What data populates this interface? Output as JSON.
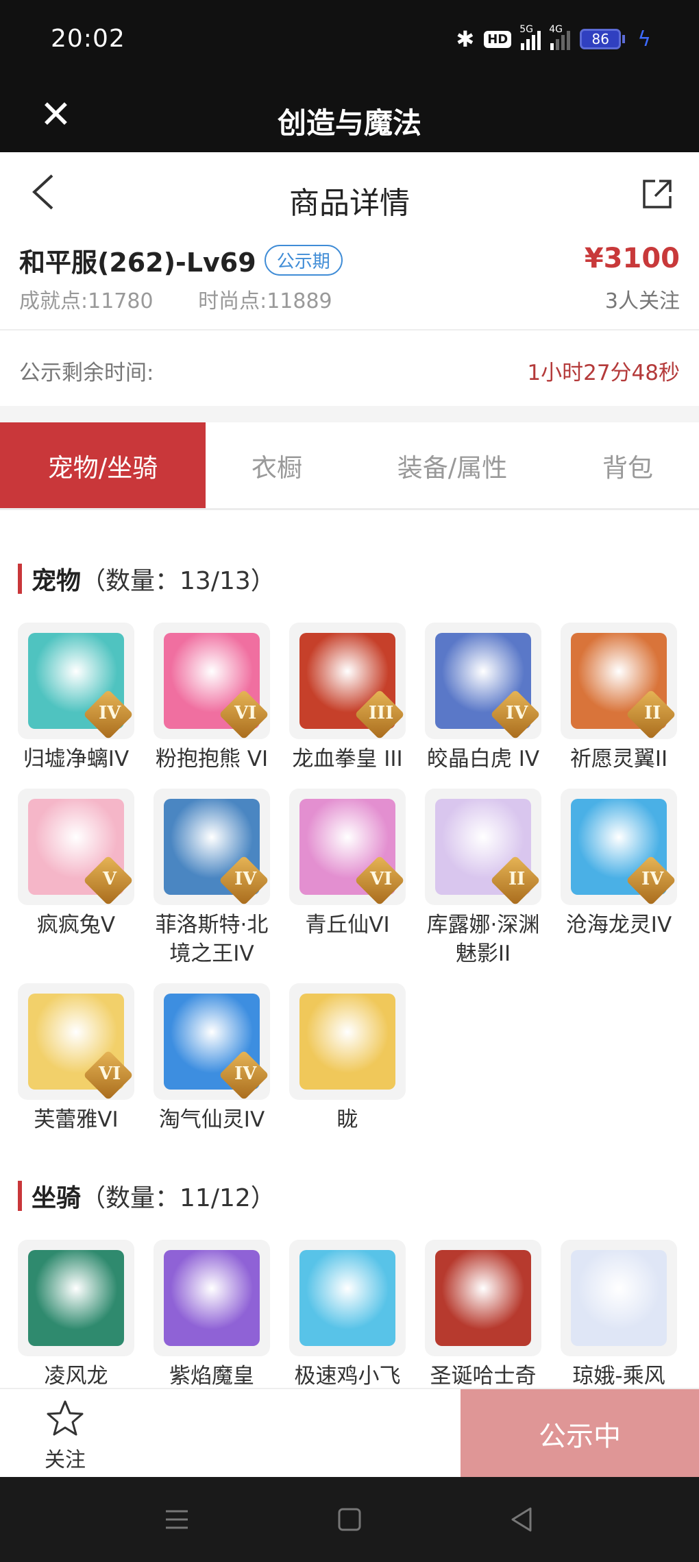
{
  "status_bar": {
    "time": "20:02",
    "hd": "HD",
    "net1": "5G",
    "net2": "4G",
    "battery": "86"
  },
  "app_bar": {
    "title": "创造与魔法"
  },
  "nav": {
    "title": "商品详情"
  },
  "product": {
    "name": "和平服(262)-Lv69",
    "badge": "公示期",
    "price": "¥3100",
    "achievement": "成就点:11780",
    "fashion": "时尚点:11889",
    "followers": "3人关注"
  },
  "timer": {
    "label": "公示剩余时间:",
    "value": "1小时27分48秒"
  },
  "tabs": [
    {
      "label": "宠物/坐骑"
    },
    {
      "label": "衣橱"
    },
    {
      "label": "装备/属性"
    },
    {
      "label": "背包"
    }
  ],
  "pets": {
    "title": "宠物",
    "count": "（数量：13/13）",
    "items": [
      {
        "label": "归墟净螭IV",
        "rank": "IV",
        "color": "#4fc3c0"
      },
      {
        "label": "粉抱抱熊 VI",
        "rank": "VI",
        "color": "#f06fa0"
      },
      {
        "label": "龙血拳皇 III",
        "rank": "III",
        "color": "#c6402a"
      },
      {
        "label": "皎晶白虎 IV",
        "rank": "IV",
        "color": "#5a78c8"
      },
      {
        "label": "祈愿灵翼II",
        "rank": "II",
        "color": "#d9743a"
      },
      {
        "label": "疯疯兔V",
        "rank": "V",
        "color": "#f5b6c8"
      },
      {
        "label": "菲洛斯特·北境之王IV",
        "rank": "IV",
        "color": "#4a86c2"
      },
      {
        "label": "青丘仙VI",
        "rank": "VI",
        "color": "#e38fd0"
      },
      {
        "label": "库露娜·深渊魅影II",
        "rank": "II",
        "color": "#d9c6ee"
      },
      {
        "label": "沧海龙灵IV",
        "rank": "IV",
        "color": "#4ab0e6"
      },
      {
        "label": "芙蕾雅VI",
        "rank": "VI",
        "color": "#f2d06a"
      },
      {
        "label": "淘气仙灵IV",
        "rank": "IV",
        "color": "#3d8ee0"
      },
      {
        "label": "眬",
        "rank": "",
        "color": "#f0c85a"
      }
    ]
  },
  "mounts": {
    "title": "坐骑",
    "count": "（数量：11/12）",
    "items": [
      {
        "label": "凌风龙",
        "color": "#2f8a6e"
      },
      {
        "label": "紫焰魔皇",
        "color": "#8f62d6"
      },
      {
        "label": "极速鸡小飞",
        "color": "#58c3e8"
      },
      {
        "label": "圣诞哈士奇",
        "color": "#b73a2e"
      },
      {
        "label": "琼娥-乘风",
        "color": "#dfe6f6"
      }
    ]
  },
  "bottom": {
    "follow": "关注",
    "action": "公示中"
  }
}
